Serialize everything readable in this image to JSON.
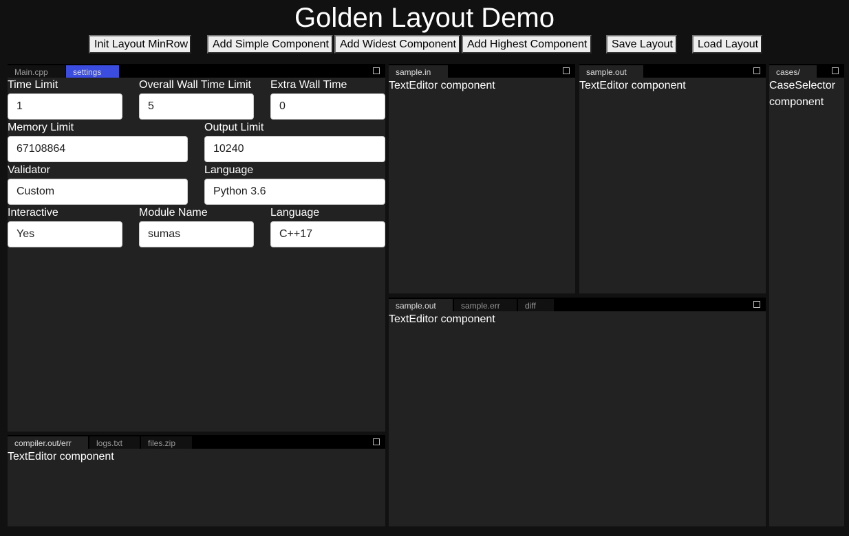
{
  "title": "Golden Layout Demo",
  "toolbar": {
    "init_layout": "Init Layout MinRow",
    "add_simple": "Add Simple Component",
    "add_widest": "Add Widest Component",
    "add_highest": "Add Highest Component",
    "save_layout": "Save Layout",
    "load_layout": "Load Layout"
  },
  "colors": {
    "active_tab": "#3b4de0",
    "panel_bg": "#222222",
    "page_bg": "#111111"
  },
  "settings_panel": {
    "tabs": [
      "Main.cpp",
      "settings"
    ],
    "active_tab": "settings",
    "fields": [
      {
        "label": "Time Limit",
        "value": "1"
      },
      {
        "label": "Overall Wall Time Limit",
        "value": "5"
      },
      {
        "label": "Extra Wall Time",
        "value": "0"
      },
      {
        "label": "Memory Limit",
        "value": "67108864"
      },
      {
        "label": "Output Limit",
        "value": "10240"
      },
      {
        "label": "Validator",
        "value": "Custom"
      },
      {
        "label": "Language",
        "value": "Python 3.6"
      },
      {
        "label": "Interactive",
        "value": "Yes"
      },
      {
        "label": "Module Name",
        "value": "sumas"
      },
      {
        "label": "Language",
        "value": "C++17"
      }
    ]
  },
  "compiler_panel": {
    "tabs": [
      "compiler.out/err",
      "logs.txt",
      "files.zip"
    ],
    "content": "TextEditor component"
  },
  "sample_in_panel": {
    "tabs": [
      "sample.in"
    ],
    "content": "TextEditor component"
  },
  "sample_out_panel": {
    "tabs": [
      "sample.out"
    ],
    "content": "TextEditor component"
  },
  "output_panel": {
    "tabs": [
      "sample.out",
      "sample.err",
      "diff"
    ],
    "content": "TextEditor component"
  },
  "cases_panel": {
    "tabs": [
      "cases/"
    ],
    "content": "CaseSelector component"
  }
}
